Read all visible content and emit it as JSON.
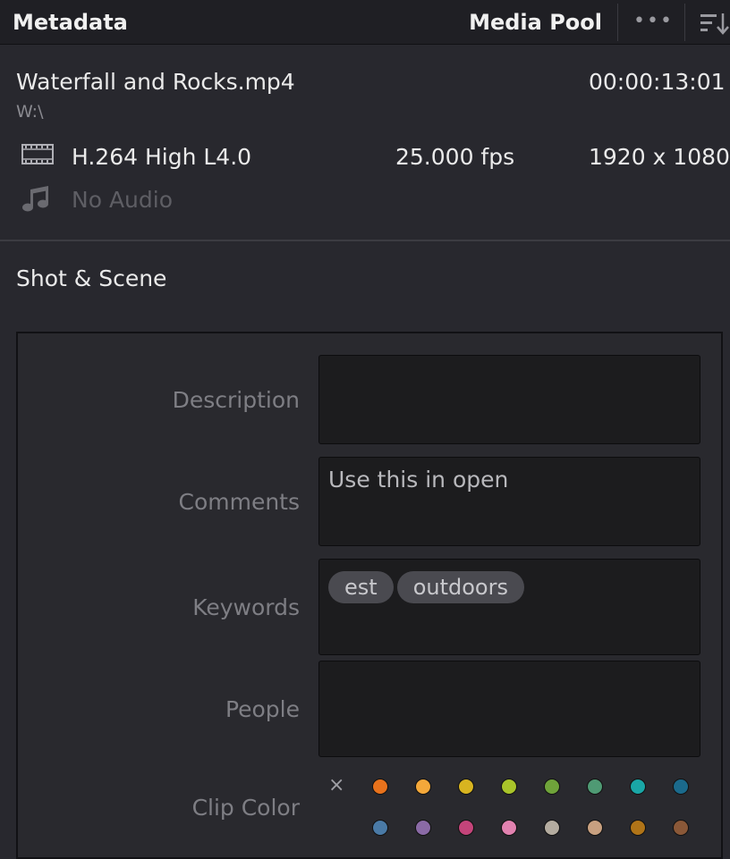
{
  "header": {
    "title": "Metadata",
    "pool_label": "Media Pool",
    "more_label": "•••"
  },
  "clip": {
    "name": "Waterfall and Rocks.mp4",
    "path": "W:\\",
    "timecode": "00:00:13:01",
    "codec": "H.264 High L4.0",
    "fps": "25.000 fps",
    "resolution": "1920 x 1080",
    "audio": "No Audio"
  },
  "section": {
    "title": "Shot & Scene"
  },
  "fields": {
    "description": {
      "label": "Description",
      "value": ""
    },
    "comments": {
      "label": "Comments",
      "value": "Use this in open"
    },
    "keywords": {
      "label": "Keywords",
      "tags": [
        "est",
        "outdoors"
      ]
    },
    "people": {
      "label": "People",
      "value": ""
    },
    "clip_color": {
      "label": "Clip Color",
      "clear_symbol": "×"
    }
  },
  "clip_colors": [
    "#e8721c",
    "#f4a83a",
    "#d8b420",
    "#a9c42a",
    "#6fa33a",
    "#4f9a74",
    "#1aa6a6",
    "#1b6a8c",
    "#4a7aa6",
    "#8a6aa6",
    "#c4447a",
    "#e282b0",
    "#b4aca0",
    "#c8a080",
    "#b07418",
    "#8a5838"
  ],
  "icons": {
    "video": "film-icon",
    "audio": "music-note-icon",
    "sort": "sort-icon"
  }
}
